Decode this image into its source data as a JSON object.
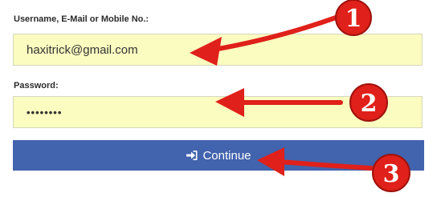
{
  "form": {
    "username_label": "Username, E-Mail or Mobile No.:",
    "username_value": "haxitrick@gmail.com",
    "password_label": "Password:",
    "password_value": "••••••••",
    "continue_label": "Continue"
  },
  "annotations": {
    "badges": [
      "1",
      "2",
      "3"
    ]
  },
  "colors": {
    "input_background": "#fafcc0",
    "button_background": "#4263ad",
    "annotation_red": "#e0201a"
  },
  "icons": {
    "continue_icon": "sign-in-icon"
  }
}
